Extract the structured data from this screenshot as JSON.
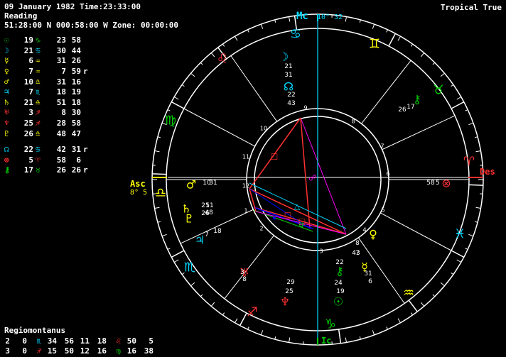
{
  "header": {
    "line1": "09 January 1982 Time:23:33:00",
    "line2": "Reading",
    "line3": "51:28:00 N 000:58:00 W Zone: 00:00:00",
    "mode": "Tropical True"
  },
  "planets": [
    {
      "glyph": "☉",
      "color": "#00d000",
      "deg": "19",
      "sign": "♑",
      "signColor": "#00d000",
      "min": "23",
      "sec": "58",
      "r": ""
    },
    {
      "glyph": "☽",
      "color": "#00d8ff",
      "deg": "21",
      "sign": "♋",
      "signColor": "#00d8ff",
      "min": "30",
      "sec": "44",
      "r": ""
    },
    {
      "glyph": "☿",
      "color": "#ffff00",
      "deg": "6",
      "sign": "♒",
      "signColor": "#ffff00",
      "min": "31",
      "sec": "26",
      "r": ""
    },
    {
      "glyph": "♀",
      "color": "#ffff00",
      "deg": "7",
      "sign": "♒",
      "signColor": "#ffff00",
      "min": "7",
      "sec": "59",
      "r": "r"
    },
    {
      "glyph": "♂",
      "color": "#ffff00",
      "deg": "10",
      "sign": "♎",
      "signColor": "#ffff00",
      "min": "31",
      "sec": "16",
      "r": ""
    },
    {
      "glyph": "♃",
      "color": "#00d8ff",
      "deg": "7",
      "sign": "♏",
      "signColor": "#00d8ff",
      "min": "18",
      "sec": "19",
      "r": ""
    },
    {
      "glyph": "♄",
      "color": "#ffff00",
      "deg": "21",
      "sign": "♎",
      "signColor": "#ffff00",
      "min": "51",
      "sec": "18",
      "r": ""
    },
    {
      "glyph": "♅",
      "color": "#ff3030",
      "deg": "3",
      "sign": "♐",
      "signColor": "#ff3030",
      "min": "8",
      "sec": "30",
      "r": ""
    },
    {
      "glyph": "♆",
      "color": "#ff3030",
      "deg": "25",
      "sign": "♐",
      "signColor": "#ff3030",
      "min": "28",
      "sec": "58",
      "r": ""
    },
    {
      "glyph": "♇",
      "color": "#ffff00",
      "deg": "26",
      "sign": "♎",
      "signColor": "#ffff00",
      "min": "48",
      "sec": "47",
      "r": ""
    },
    {
      "glyph": "☊",
      "color": "#00d8ff",
      "deg": "22",
      "sign": "♋",
      "signColor": "#00d8ff",
      "min": "42",
      "sec": "31",
      "r": "r"
    },
    {
      "glyph": "⊗",
      "color": "#ff3030",
      "deg": "5",
      "sign": "♈",
      "signColor": "#ff3030",
      "min": "58",
      "sec": "6",
      "r": ""
    },
    {
      "glyph": "⚷",
      "color": "#00d000",
      "deg": "17",
      "sign": "♉",
      "signColor": "#00d000",
      "min": "26",
      "sec": "26",
      "r": "r"
    }
  ],
  "house_system": "Regiomontanus",
  "house_cusps": [
    {
      "a": "2",
      "b": "0",
      "sign": "♏",
      "signColor": "#00d8ff",
      "c": "34",
      "d": "56"
    },
    {
      "a": "11",
      "b": "18",
      "sign": "♌",
      "signColor": "#ff3030",
      "c": "50",
      "d": "5"
    },
    {
      "a": "3",
      "b": "0",
      "sign": "♐",
      "signColor": "#ff3030",
      "c": "15",
      "d": "50"
    },
    {
      "a": "12",
      "b": "16",
      "sign": "♍",
      "signColor": "#00d000",
      "c": "16",
      "d": "38"
    }
  ],
  "angles": {
    "mc": "Mc",
    "mc_val": "10° 32",
    "ic": "Ic",
    "asc": "Asc",
    "asc_val": "8° 5",
    "des": "Des"
  },
  "zodiac": [
    {
      "glyph": "♋",
      "color": "#00d8ff"
    },
    {
      "glyph": "♊",
      "color": "#ffff00"
    },
    {
      "glyph": "♉",
      "color": "#00d000"
    },
    {
      "glyph": "♈",
      "color": "#ff3030"
    },
    {
      "glyph": "♓",
      "color": "#00d8ff"
    },
    {
      "glyph": "♒",
      "color": "#ffff00"
    },
    {
      "glyph": "♑",
      "color": "#00d000"
    },
    {
      "glyph": "♐",
      "color": "#ff3030"
    },
    {
      "glyph": "♏",
      "color": "#00d8ff"
    },
    {
      "glyph": "♎",
      "color": "#ffff00"
    },
    {
      "glyph": "♍",
      "color": "#00d000"
    },
    {
      "glyph": "♌",
      "color": "#ff3030"
    }
  ],
  "house_numbers": [
    "1",
    "2",
    "3",
    "4",
    "5",
    "6",
    "7",
    "8",
    "9",
    "10",
    "11",
    "12"
  ],
  "wheel_placements": [
    {
      "glyph": "☽",
      "color": "#00d8ff",
      "l1": "21",
      "l2": "31"
    },
    {
      "glyph": "☊",
      "color": "#00d8ff",
      "l1": "22",
      "l2": "43"
    },
    {
      "glyph": "⚷",
      "color": "#00d000",
      "l1": "26",
      "l2": "17"
    },
    {
      "glyph": "⊗",
      "color": "#ff3030",
      "l1": "58",
      "l2": "5"
    },
    {
      "glyph": "♀",
      "color": "#ffff00",
      "l1": "43",
      "l2": "8",
      "l3": "7"
    },
    {
      "glyph": "☿",
      "color": "#ffff00",
      "l1": "31",
      "l2": "6"
    },
    {
      "glyph": "⚷",
      "color": "#00d000",
      "l1": "22",
      "l2": "24"
    },
    {
      "glyph": "☉",
      "color": "#00d000",
      "l1": "19"
    },
    {
      "glyph": "♆",
      "color": "#ff3030",
      "l1": "29",
      "l2": "25"
    },
    {
      "glyph": "♅",
      "color": "#ff3030",
      "l1": "3",
      "l2": "8"
    },
    {
      "glyph": "♃",
      "color": "#00d8ff",
      "l1": "7",
      "l2": "18"
    },
    {
      "glyph": "♇",
      "color": "#ffff00",
      "l1": "26",
      "l2": "48"
    },
    {
      "glyph": "♄",
      "color": "#ffff00",
      "l1": "21",
      "l2": "51"
    },
    {
      "glyph": "♂",
      "color": "#ffff00",
      "l1": "10",
      "l2": "31"
    }
  ],
  "aspect_symbols": [
    {
      "glyph": "□",
      "color": "#ff3030"
    },
    {
      "glyph": "△",
      "color": "#00d8ff"
    },
    {
      "glyph": "□",
      "color": "#ff3030"
    },
    {
      "glyph": "□",
      "color": "#ff3030"
    },
    {
      "glyph": "☍",
      "color": "#ff00ff"
    },
    {
      "glyph": "✶",
      "color": "#0000ff"
    },
    {
      "glyph": "q",
      "color": "#00d000"
    }
  ]
}
